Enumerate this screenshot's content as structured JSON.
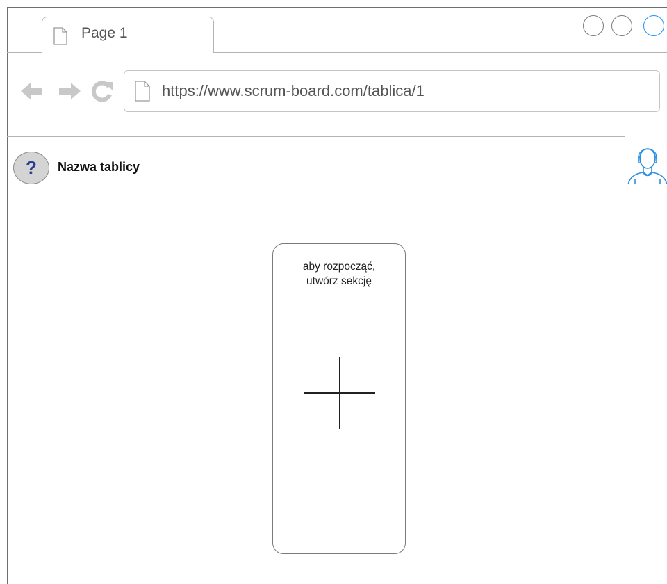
{
  "browser": {
    "tab": {
      "title": "Page 1",
      "icon": "page-icon"
    },
    "window_controls": [
      "minimize",
      "maximize",
      "close"
    ],
    "nav": {
      "back_icon": "arrow-left-icon",
      "forward_icon": "arrow-right-icon",
      "reload_icon": "reload-icon"
    },
    "address_bar": {
      "icon": "page-icon",
      "url": "https://www.scrum-board.com/tablica/1"
    },
    "accent_color": "#1e90ff"
  },
  "header": {
    "help_glyph": "?",
    "board_name": "Nazwa tablicy",
    "avatar_icon": "user-avatar-icon"
  },
  "board": {
    "empty_section": {
      "hint": "aby rozpocząć,\nutwórz sekcję",
      "add_icon": "plus-icon"
    }
  }
}
